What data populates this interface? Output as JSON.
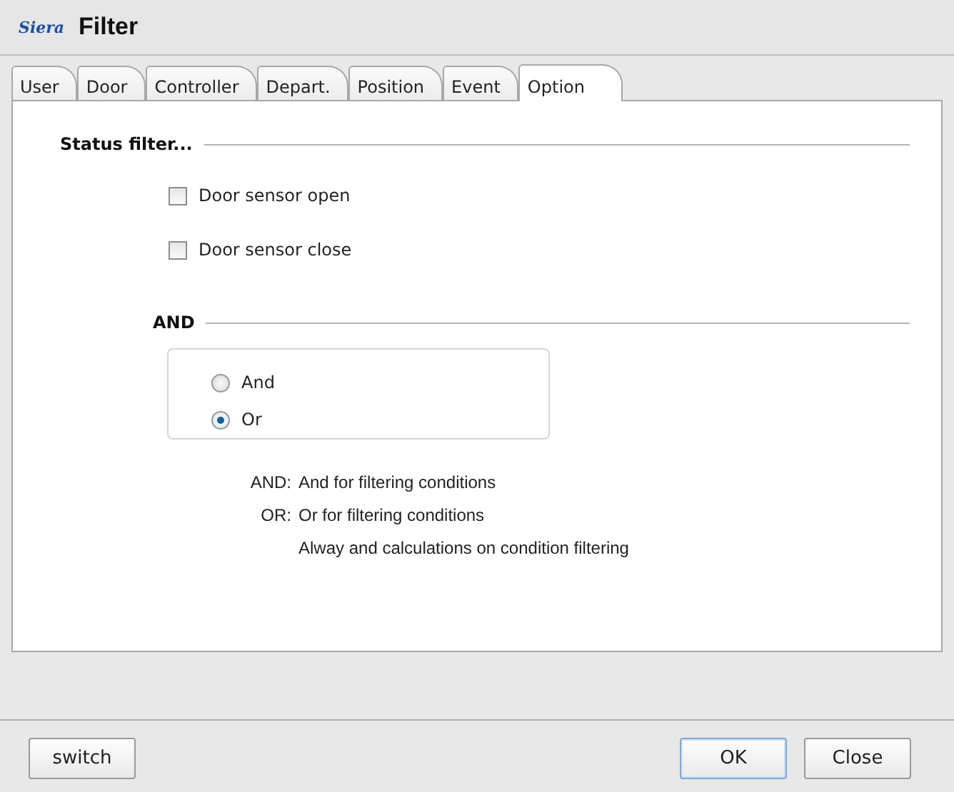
{
  "window": {
    "logo": "Siera",
    "title": "Filter"
  },
  "tabs": [
    {
      "label": "User",
      "selected": false
    },
    {
      "label": "Door",
      "selected": false
    },
    {
      "label": "Controller",
      "selected": false
    },
    {
      "label": "Depart.",
      "selected": false
    },
    {
      "label": "Position",
      "selected": false
    },
    {
      "label": "Event",
      "selected": false
    },
    {
      "label": "Option",
      "selected": true
    }
  ],
  "status_filter": {
    "heading": "Status filter...",
    "options": [
      {
        "label": "Door sensor open",
        "checked": false
      },
      {
        "label": "Door sensor close",
        "checked": false
      }
    ]
  },
  "logic": {
    "heading": "AND",
    "options": [
      {
        "label": "And",
        "selected": false
      },
      {
        "label": "Or",
        "selected": true
      }
    ]
  },
  "notes": [
    {
      "label": "AND:",
      "text": "And for filtering conditions"
    },
    {
      "label": "OR:",
      "text": "Or for filtering conditions"
    },
    {
      "text": "Alway and calculations on condition filtering"
    }
  ],
  "buttons": [
    {
      "label": "switch",
      "kind": "left"
    },
    {
      "label": "OK",
      "kind": "default"
    },
    {
      "label": "Close",
      "kind": "normal"
    }
  ]
}
